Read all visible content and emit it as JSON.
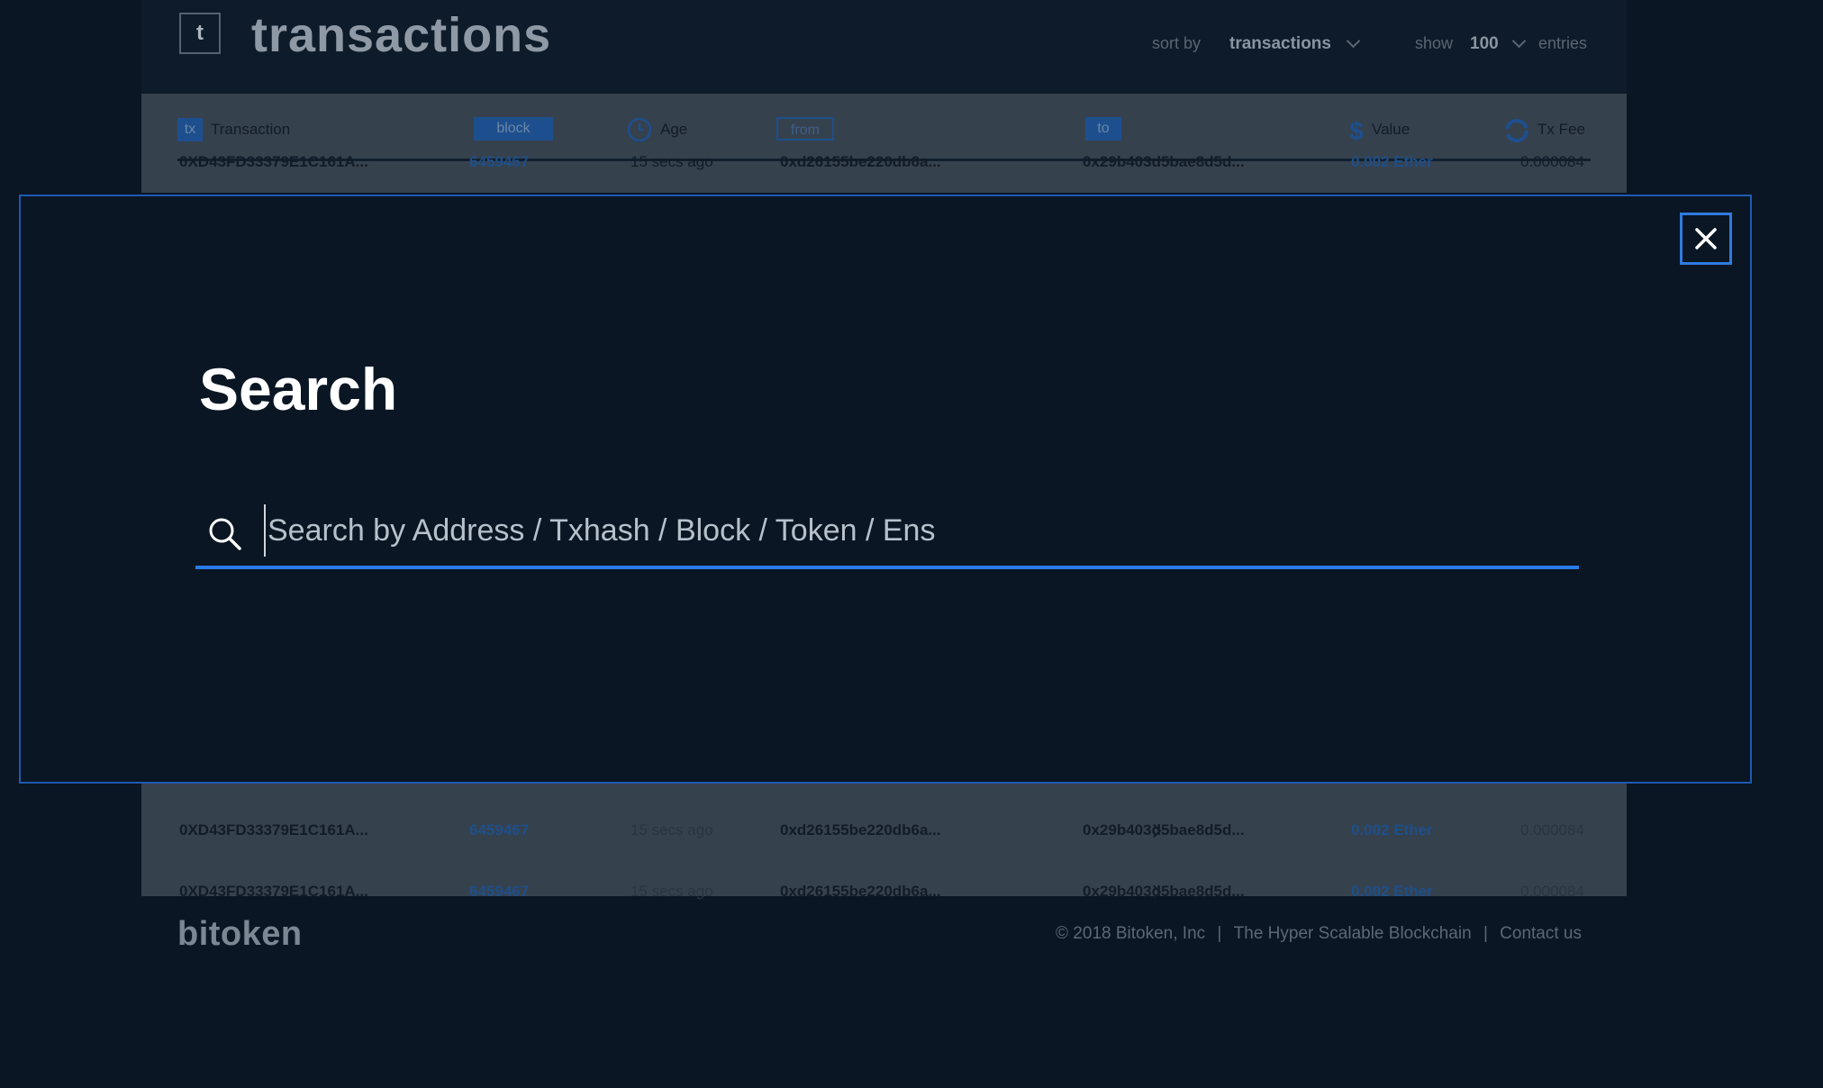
{
  "header": {
    "logo_letter": "t",
    "title": "transactions",
    "sort_label": "sort by",
    "sort_value": "transactions",
    "show_label": "show",
    "show_value": "100",
    "entries_label": "entries"
  },
  "table": {
    "columns": {
      "tx_badge": "tx",
      "transaction": "Transaction",
      "block": "block",
      "age": "Age",
      "from": "from",
      "to": "to",
      "value": "Value",
      "fee": "Tx Fee"
    },
    "rows": [
      {
        "tx": "0XD43FD33379E1C161A...",
        "block": "6459467",
        "age": "15 secs ago",
        "from": "0xd26155be220db6a...",
        "to": "0x29b403d5bae8d5d...",
        "value": "0.002 Ether",
        "fee": "0.000084"
      },
      {
        "tx": "0XD43FD33379E1C161A...",
        "block": "6459467",
        "age": "15 secs ago",
        "from": "0xd26155be220db6a...",
        "to": "0x29b403d5bae8d5d...",
        "value": "0.002 Ether",
        "fee": "0.000084"
      },
      {
        "tx": "0XD43FD33379E1C161A...",
        "block": "6459467",
        "age": "15 secs ago",
        "from": "0xd26155be220db6a...",
        "to": "0x29b403d5bae8d5d...",
        "value": "0.002 Ether",
        "fee": "0.000084"
      }
    ]
  },
  "modal": {
    "title": "Search",
    "search_placeholder": "Search by Address / Txhash / Block / Token / Ens",
    "search_value": ""
  },
  "footer": {
    "brand": "bitoken",
    "copyright": "© 2018 Bitoken, Inc",
    "tagline": "The Hyper Scalable Blockchain",
    "contact": "Contact us",
    "separator": "|"
  },
  "colors": {
    "background": "#0a1623",
    "accent": "#2a7be8",
    "modal_border": "#1e5ab0"
  }
}
